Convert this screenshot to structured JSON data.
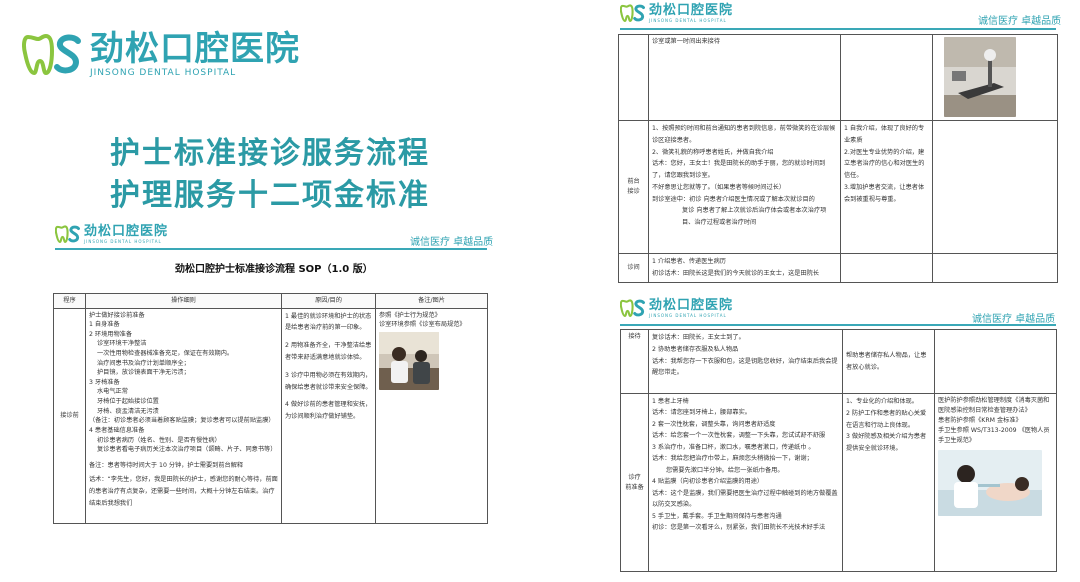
{
  "cover": {
    "logo_cn": "劲松口腔医院",
    "logo_en": "JINSONG DENTAL HOSPITAL",
    "title_line1": "护士标准接诊服务流程",
    "title_line2": "护理服务十二项金标准"
  },
  "page_header": {
    "logo_cn": "劲松口腔医院",
    "logo_en": "JINSONG DENTAL HOSPITAL",
    "slogan": "诚信医疗 卓越品质"
  },
  "sop": {
    "title": "劲松口腔护士标准接诊流程 SOP（1.0 版）",
    "headers": [
      "程序",
      "操作细则",
      "原因/目的",
      "备注/图片"
    ],
    "stage": "接诊前",
    "steps": [
      "护士做好接诊前准备",
      "1 自身准备",
      "2 环境用物准备",
      "诊室环境干净整洁",
      "一次性用物检查器械准备充足，保证在有效期内。",
      "治疗间患书及治疗计划单顺序全；",
      "护目镜，放诊镜表面干净无污渍；",
      "3 牙椅准备",
      "水电气正常",
      "牙椅位于起始接诊位置",
      "牙椅、痰盂清洁无污渍",
      "（备注：初诊患者必须当着顾客贴监膜；复诊患者可以提前贴监膜）",
      "4 患者基础信息准备",
      "初诊患者病历（姓名、性别、是否有慢性病）",
      "复诊患者看电子病历关注本次治疗项目（颌畸、片子、同意书等）"
    ],
    "note": "备注：患者等待时间大于 10 分钟，护士需要到前台解释",
    "script": "话术：“李先生，您好，我是田院长的护士，感谢您的耐心等待，前面的患者治疗有点复杂，还需要一些时间，大概十分钟左右结束。治疗结束后我想我们",
    "reasons": [
      "1 最佳的就诊环境和护士的状态是给患者治疗前的第一印象。",
      "2 用物准备齐全，干净整洁给患者带来舒适满意地就诊体验。",
      "3 诊疗中用物必须在有效期内，确保给患者就诊带来安全保障。",
      "4 做好诊前的患者管理和安抚，为诊间顺利治疗做好铺垫。"
    ],
    "remark_line1": "参照《护士行为规范》",
    "remark_line2": "诊室环境参照《诊室布局规范》"
  },
  "page2": {
    "top_row_text": "诊室或第一时间出来接待",
    "stage_reception": "前台\n接诊",
    "reception_steps": [
      "1、按照预约时间和前台通知的患者到院信息，前带微笑的在诊层候诊区迎接患者。",
      "2、微笑礼貌的称呼患者姓氏，并做自我介绍",
      "话术：您好，王女士！我是田院长的助手于丽，您的就诊时间到了，请您跟我到诊室。",
      "不好意思让您就等了。（如果患者等候时间过长）",
      "到诊室途中：初诊  向患者介绍医生情况或了解本次就诊目的",
      "复诊  向患者了解上次就诊后治疗体会或者本次治疗项目、治疗过程或者治疗时间"
    ],
    "reception_reasons": [
      "1 自我介绍，体现了良好的专业素质",
      "2.对医生专业优势的介绍，建立患者治疗的信心和对医生的信任。",
      "3.增加护患者交流，让患者体会到被重视与尊重。"
    ],
    "stage_inroom": "诊间",
    "inroom_steps": [
      "1 介绍患者、传递医生病历",
      "初诊话术：田院长这是我们的今天就诊的王女士，这是田院长"
    ]
  },
  "page3": {
    "stage_reception": "接待",
    "reception_steps": [
      "复诊话术：田院长，王女士到了。",
      "2 协助患者储存衣服及私人物品",
      "话术：我帮您存一下衣服和包，这是钥匙您收好，治疗结束后我会提醒您带走。"
    ],
    "reception_reason": "帮助患者储存私人物品，让患者放心就诊。",
    "stage_prep": "诊疗\n前准备",
    "prep_steps": [
      "1 患者上牙椅",
      "话术：请您座到牙椅上，腰部靠实。",
      "2 套一次性枕套，调整头靠，询问患者舒适度",
      "话术：给您套一个一次性枕套，调整一下头靠，您试试舒不舒服",
      "3 系治疗巾，准备口杯，漱口水，嘱患者漱口，传递纸巾 。",
      "话术：我给您把治疗巾带上，麻烦您头稍微抬一下，谢谢；",
      "您需要先漱口半分钟。给您一张纸巾备用。",
      "4 贴监膜（向初诊患者介绍监膜的用途）",
      "话术：这个是监膜，我们需要把医生治疗过程中触碰到的地方做覆盖以防交叉感染。",
      "5 手卫生，戴手套。手卫生期间保持与患者沟通",
      "初诊：您是第一次看牙么，别紧张，我们田院长不光技术好手法"
    ],
    "prep_reasons": [
      "1、专业化的介绍和体现。",
      "2 防护工作和患者的贴心关爱在语言和行动上良体现。",
      "3 做好院感及相关介绍为患者提供安全就诊环境。"
    ],
    "prep_remark": [
      "医护防护参照劲松管理制度《消毒灭菌和医院感染控制日常检查管理办法》",
      "患者防护参照《KRM 金标准》",
      "手卫生参照 WS/T313-2009 《医物人员手卫生规范》"
    ]
  },
  "colors": {
    "brand_teal": "#2fa3b2",
    "title_teal": "#2b9aa5"
  },
  "icons": [
    "tooth-logo-icon"
  ]
}
